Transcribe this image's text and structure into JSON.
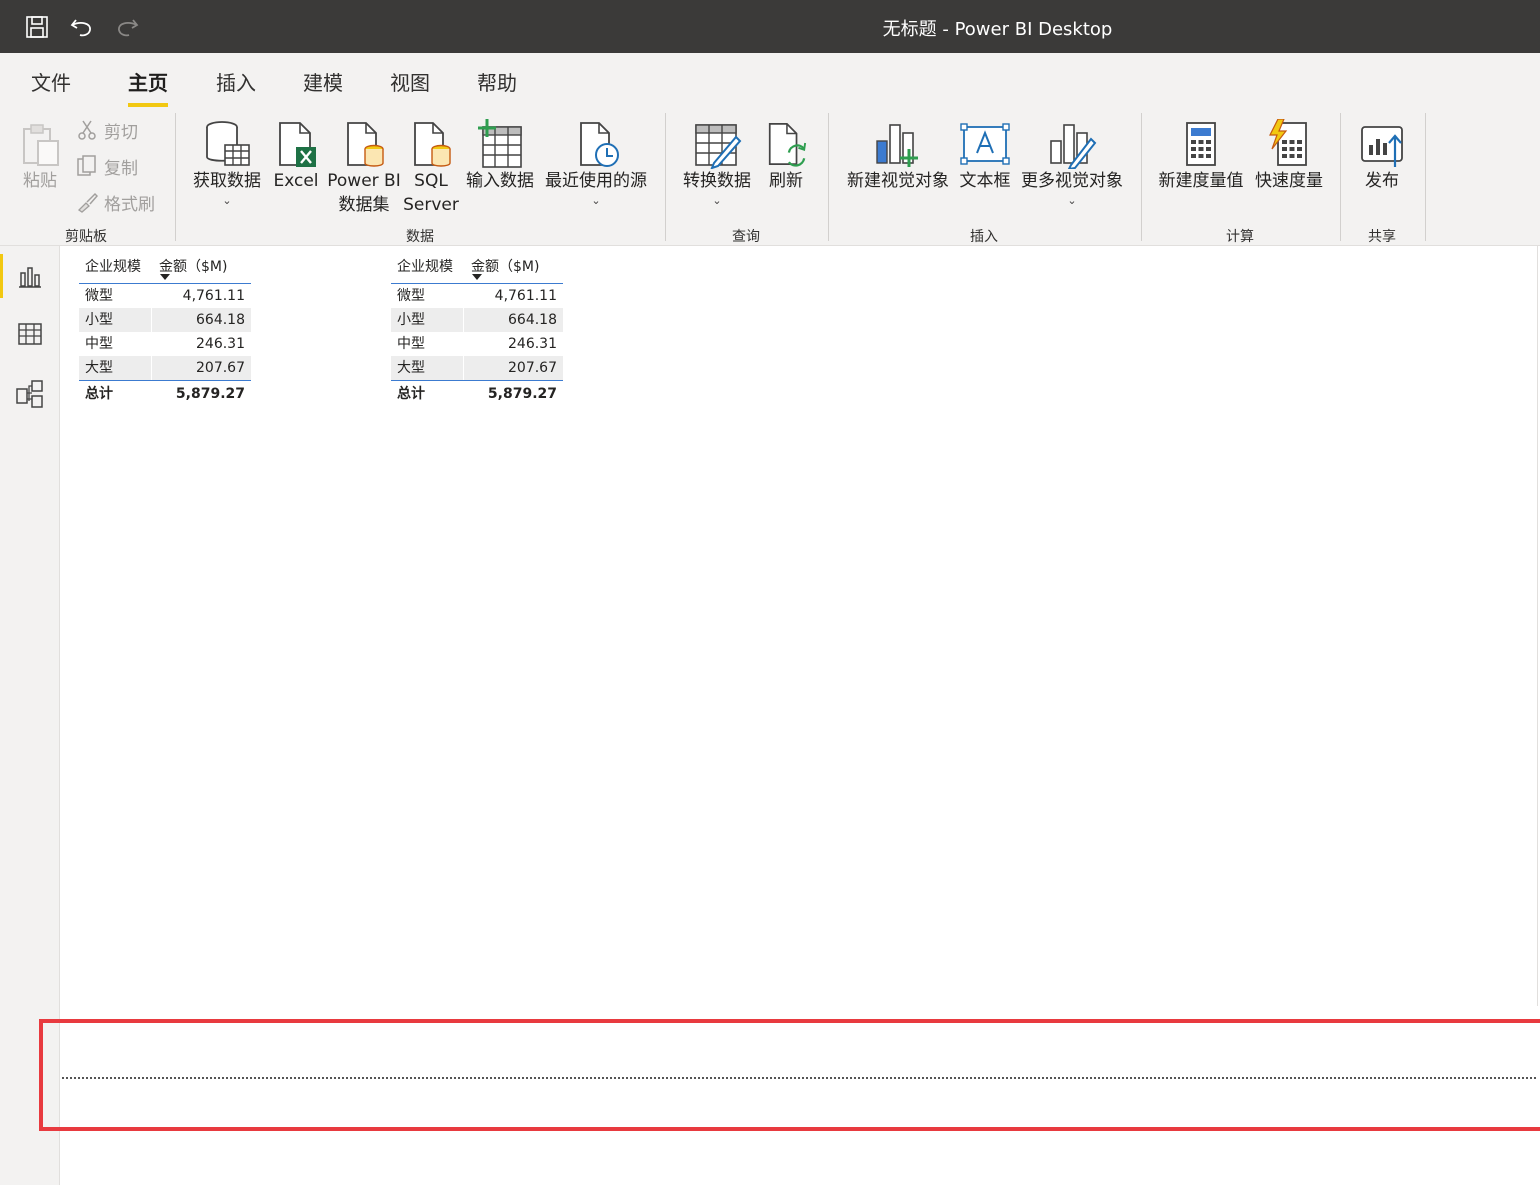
{
  "window": {
    "title": "无标题 - Power BI Desktop"
  },
  "tabs": [
    {
      "label": "文件"
    },
    {
      "label": "主页",
      "active": true
    },
    {
      "label": "插入"
    },
    {
      "label": "建模"
    },
    {
      "label": "视图"
    },
    {
      "label": "帮助"
    }
  ],
  "ribbon": {
    "clipboard": {
      "paste": "粘贴",
      "cut": "剪切",
      "copy": "复制",
      "format_painter": "格式刷",
      "group": "剪贴板"
    },
    "data": {
      "get_data": "获取数据",
      "excel": "Excel",
      "pbi_line1": "Power BI",
      "pbi_line2": "数据集",
      "sql_line1": "SQL",
      "sql_line2": "Server",
      "enter_data": "输入数据",
      "recent_sources": "最近使用的源",
      "group": "数据"
    },
    "query": {
      "transform": "转换数据",
      "refresh": "刷新",
      "group": "查询"
    },
    "insert": {
      "new_visual": "新建视觉对象",
      "text_box": "文本框",
      "more_visuals": "更多视觉对象",
      "group": "插入"
    },
    "calc": {
      "new_measure": "新建度量值",
      "quick_measure": "快速度量",
      "group": "计算"
    },
    "share": {
      "publish": "发布",
      "group": "共享"
    }
  },
  "tables": [
    {
      "headers": [
        "企业规模",
        "金额（$M)"
      ],
      "rows": [
        {
          "label": "微型",
          "value": "4,761.11"
        },
        {
          "label": "小型",
          "value": "664.18"
        },
        {
          "label": "中型",
          "value": "246.31"
        },
        {
          "label": "大型",
          "value": "207.67"
        }
      ],
      "total": {
        "label": "总计",
        "value": "5,879.27"
      }
    },
    {
      "headers": [
        "企业规模",
        "金额（$M)"
      ],
      "rows": [
        {
          "label": "微型",
          "value": "4,761.11"
        },
        {
          "label": "小型",
          "value": "664.18"
        },
        {
          "label": "中型",
          "value": "246.31"
        },
        {
          "label": "大型",
          "value": "207.67"
        }
      ],
      "total": {
        "label": "总计",
        "value": "5,879.27"
      }
    }
  ],
  "colors": {
    "accent": "#f2c811",
    "titlebar": "#3b3a39",
    "highlight": "#e83a3f",
    "table_rule": "#3c7bd0"
  }
}
